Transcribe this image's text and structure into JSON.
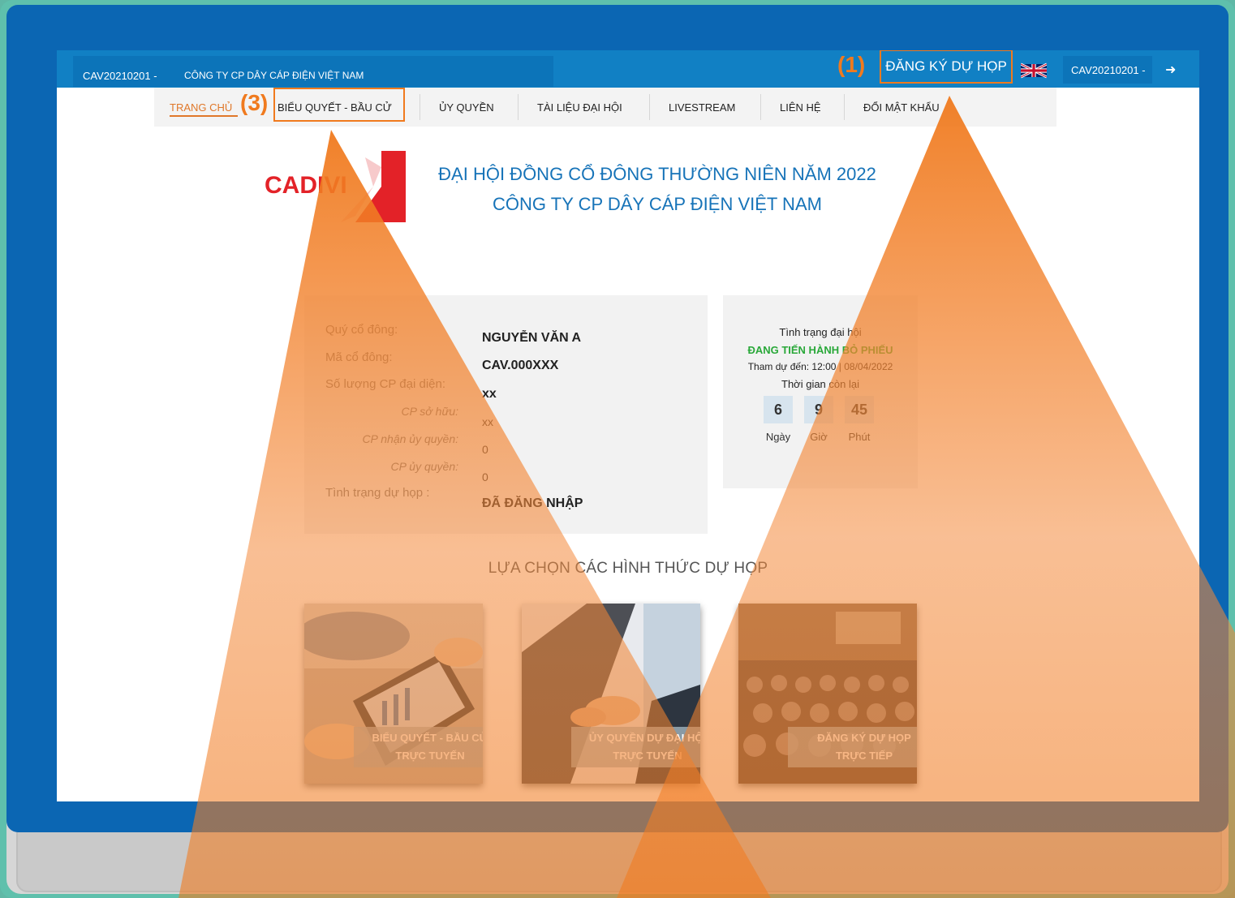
{
  "topbar": {
    "company_code": "CAV20210201 -",
    "company_name": "CÔNG TY CP DÂY CÁP ĐIỆN VIỆT NAM",
    "annotation_1": "(1)",
    "register_label": "ĐĂNG KÝ DỰ HỌP",
    "flag_icon": "uk-flag-icon",
    "user_code": "CAV20210201 -",
    "logout_icon": "sign-out-icon"
  },
  "nav": {
    "items": [
      {
        "label": "TRANG CHỦ"
      },
      {
        "label": "BIỂU QUYẾT - BẦU CỬ"
      },
      {
        "label": "ỦY QUYỀN"
      },
      {
        "label": "TÀI LIỆU ĐẠI HỘI"
      },
      {
        "label": "LIVESTREAM"
      },
      {
        "label": "LIÊN HỆ"
      },
      {
        "label": "ĐỔI MẬT KHẨU"
      }
    ],
    "annotation_3": "(3)"
  },
  "header": {
    "logo_text": "CADIVI",
    "title_line1": "ĐẠI HỘI ĐỒNG CỔ ĐÔNG THƯỜNG NIÊN NĂM 2022",
    "title_line2": "CÔNG TY CP DÂY CÁP ĐIỆN VIỆT NAM"
  },
  "shareholder": {
    "labels": {
      "name": "Quý cổ đông:",
      "code": "Mã cổ đông:",
      "shares": "Số lượng CP đại diện:",
      "owned": "CP sở hữu:",
      "received": "CP nhận ủy quyền:",
      "delegated": "CP ủy quyền:",
      "status": "Tình trạng dự họp :"
    },
    "values": {
      "name": "NGUYỄN VĂN A",
      "code": "CAV.000XXX",
      "shares": "xx",
      "owned": "xx",
      "received": "0",
      "delegated": "0",
      "status": "ĐÃ ĐĂNG NHẬP"
    }
  },
  "meeting_status": {
    "title": "Tình trạng đại hội",
    "state": "ĐANG TIẾN HÀNH BỎ PHIẾU",
    "deadline": "Tham dự đến: 12:00 | 08/04/2022",
    "remaining_label": "Thời gian còn lại",
    "countdown": [
      {
        "value": "6",
        "unit": "Ngày"
      },
      {
        "value": "9",
        "unit": "Giờ"
      },
      {
        "value": "45",
        "unit": "Phút"
      }
    ]
  },
  "options": {
    "title": "LỰA CHỌN CÁC HÌNH THỨC DỰ HỌP",
    "cards": [
      {
        "line1": "BIỂU QUYẾT - BẦU CỬ",
        "line2": "TRỰC TUYẾN"
      },
      {
        "line1": "ỦY QUYỀN DỰ ĐẠI HỘI",
        "line2": "TRỰC TUYẾN"
      },
      {
        "line1": "ĐĂNG KÝ DỰ HỌP",
        "line2": "TRỰC TIẾP"
      }
    ]
  },
  "colors": {
    "accent_orange": "#f07a1e",
    "brand_blue": "#1180c4",
    "title_blue": "#1673b8",
    "status_green": "#29a839"
  }
}
